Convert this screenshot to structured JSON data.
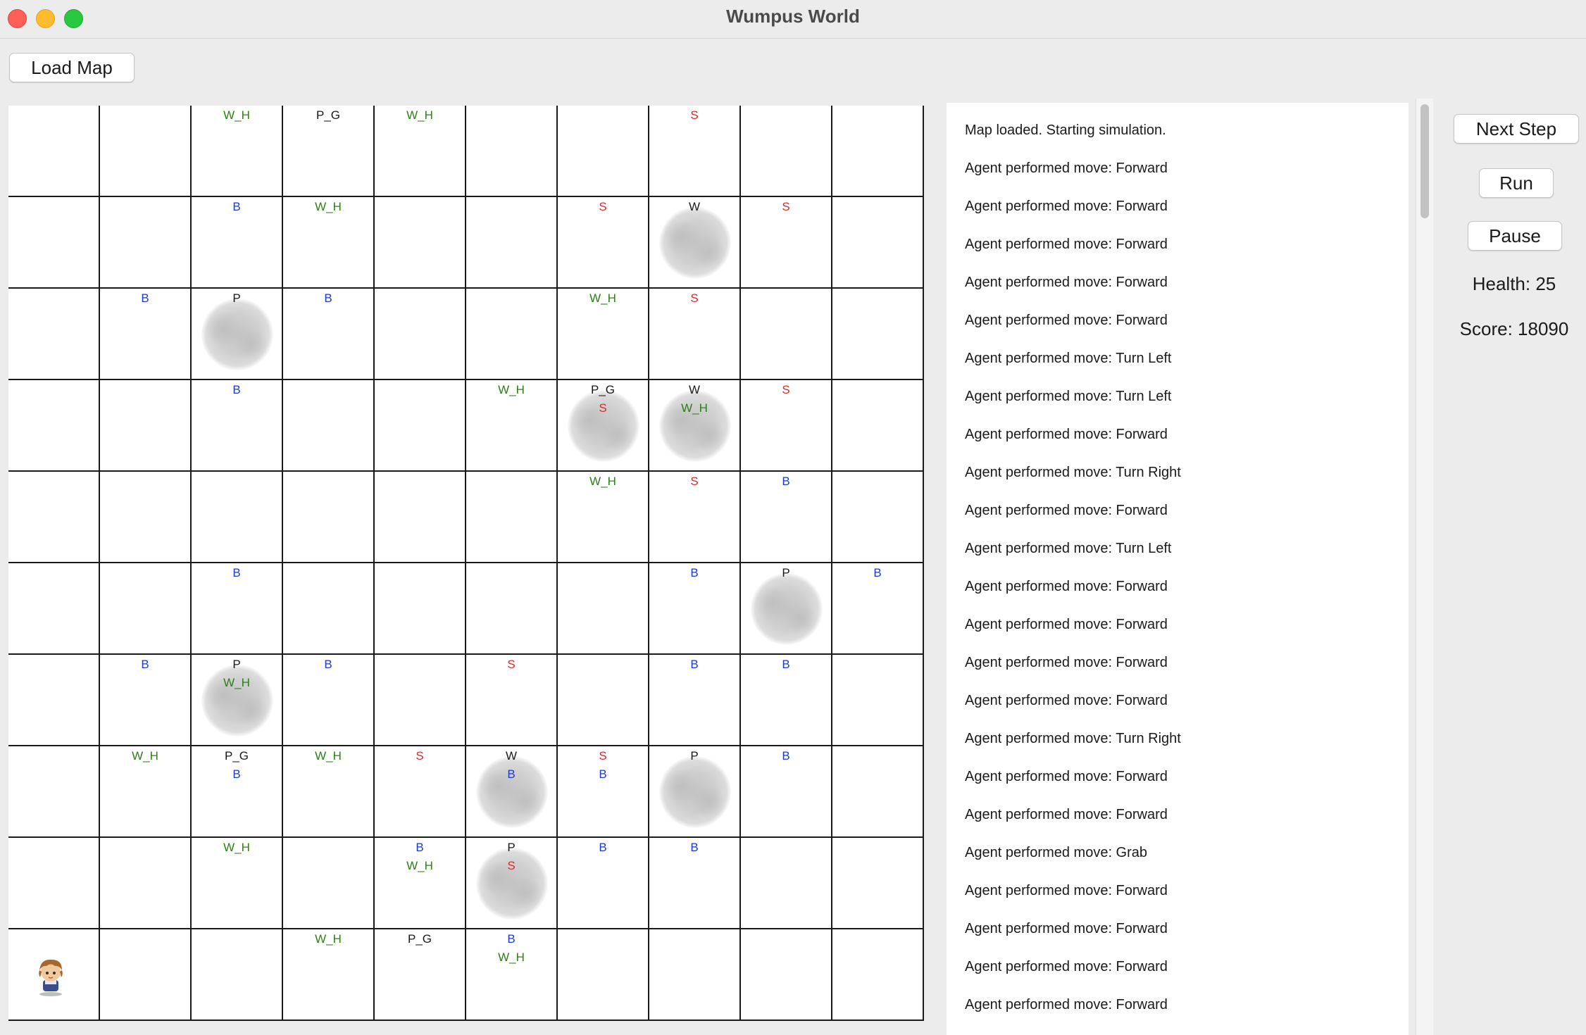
{
  "window": {
    "title": "Wumpus World"
  },
  "toolbar": {
    "load_map_label": "Load Map"
  },
  "controls": {
    "next_step_label": "Next Step",
    "run_label": "Run",
    "pause_label": "Pause",
    "health_text": "Health: 25",
    "score_text": "Score: 18090"
  },
  "legend_colors": {
    "P_G": "#1a1a1a",
    "P": "#1a1a1a",
    "W": "#1a1a1a",
    "S": "#d62b2b",
    "B": "#1c3bd0",
    "W_H": "#2e7d1a"
  },
  "grid": {
    "rows": 10,
    "cols": 10,
    "cells": [
      {
        "r": 0,
        "c": 2,
        "labels": [
          "W_H"
        ]
      },
      {
        "r": 0,
        "c": 3,
        "labels": [
          "P_G"
        ]
      },
      {
        "r": 0,
        "c": 4,
        "labels": [
          "W_H"
        ]
      },
      {
        "r": 0,
        "c": 7,
        "labels": [
          "S"
        ]
      },
      {
        "r": 1,
        "c": 2,
        "labels": [
          "B"
        ]
      },
      {
        "r": 1,
        "c": 3,
        "labels": [
          "W_H"
        ]
      },
      {
        "r": 1,
        "c": 6,
        "labels": [
          "S"
        ]
      },
      {
        "r": 1,
        "c": 7,
        "labels": [
          "W"
        ],
        "fog": true
      },
      {
        "r": 1,
        "c": 8,
        "labels": [
          "S"
        ]
      },
      {
        "r": 2,
        "c": 1,
        "labels": [
          "B"
        ]
      },
      {
        "r": 2,
        "c": 2,
        "labels": [
          "P"
        ],
        "fog": true
      },
      {
        "r": 2,
        "c": 3,
        "labels": [
          "B"
        ]
      },
      {
        "r": 2,
        "c": 6,
        "labels": [
          "W_H"
        ]
      },
      {
        "r": 2,
        "c": 7,
        "labels": [
          "S"
        ]
      },
      {
        "r": 3,
        "c": 2,
        "labels": [
          "B"
        ]
      },
      {
        "r": 3,
        "c": 5,
        "labels": [
          "W_H"
        ]
      },
      {
        "r": 3,
        "c": 6,
        "labels": [
          "P_G",
          "S"
        ],
        "fog": true
      },
      {
        "r": 3,
        "c": 7,
        "labels": [
          "W",
          "W_H"
        ],
        "fog": true
      },
      {
        "r": 3,
        "c": 8,
        "labels": [
          "S"
        ]
      },
      {
        "r": 4,
        "c": 6,
        "labels": [
          "W_H"
        ]
      },
      {
        "r": 4,
        "c": 7,
        "labels": [
          "S"
        ]
      },
      {
        "r": 4,
        "c": 8,
        "labels": [
          "B"
        ]
      },
      {
        "r": 5,
        "c": 2,
        "labels": [
          "B"
        ]
      },
      {
        "r": 5,
        "c": 7,
        "labels": [
          "B"
        ]
      },
      {
        "r": 5,
        "c": 8,
        "labels": [
          "P"
        ],
        "fog": true
      },
      {
        "r": 5,
        "c": 9,
        "labels": [
          "B"
        ]
      },
      {
        "r": 6,
        "c": 1,
        "labels": [
          "B"
        ]
      },
      {
        "r": 6,
        "c": 2,
        "labels": [
          "P",
          "W_H"
        ],
        "fog": true
      },
      {
        "r": 6,
        "c": 3,
        "labels": [
          "B"
        ]
      },
      {
        "r": 6,
        "c": 5,
        "labels": [
          "S"
        ]
      },
      {
        "r": 6,
        "c": 7,
        "labels": [
          "B"
        ]
      },
      {
        "r": 6,
        "c": 8,
        "labels": [
          "B"
        ]
      },
      {
        "r": 7,
        "c": 1,
        "labels": [
          "W_H"
        ]
      },
      {
        "r": 7,
        "c": 2,
        "labels": [
          "P_G",
          "B"
        ]
      },
      {
        "r": 7,
        "c": 3,
        "labels": [
          "W_H"
        ]
      },
      {
        "r": 7,
        "c": 4,
        "labels": [
          "S"
        ]
      },
      {
        "r": 7,
        "c": 5,
        "labels": [
          "W",
          "B"
        ],
        "fog": true
      },
      {
        "r": 7,
        "c": 6,
        "labels": [
          "S",
          "B"
        ]
      },
      {
        "r": 7,
        "c": 7,
        "labels": [
          "P"
        ],
        "fog": true
      },
      {
        "r": 7,
        "c": 8,
        "labels": [
          "B"
        ]
      },
      {
        "r": 8,
        "c": 2,
        "labels": [
          "W_H"
        ]
      },
      {
        "r": 8,
        "c": 4,
        "labels": [
          "B",
          "W_H"
        ]
      },
      {
        "r": 8,
        "c": 5,
        "labels": [
          "P",
          "S"
        ],
        "fog": true
      },
      {
        "r": 8,
        "c": 6,
        "labels": [
          "B"
        ]
      },
      {
        "r": 8,
        "c": 7,
        "labels": [
          "B"
        ]
      },
      {
        "r": 9,
        "c": 0,
        "labels": [],
        "agent": true
      },
      {
        "r": 9,
        "c": 3,
        "labels": [
          "W_H"
        ]
      },
      {
        "r": 9,
        "c": 4,
        "labels": [
          "P_G"
        ]
      },
      {
        "r": 9,
        "c": 5,
        "labels": [
          "B",
          "W_H"
        ]
      }
    ]
  },
  "log": [
    "Map loaded. Starting simulation.",
    "Agent performed move: Forward",
    "Agent performed move: Forward",
    "Agent performed move: Forward",
    "Agent performed move: Forward",
    "Agent performed move: Forward",
    "Agent performed move: Turn Left",
    "Agent performed move: Turn Left",
    "Agent performed move: Forward",
    "Agent performed move: Turn Right",
    "Agent performed move: Forward",
    "Agent performed move: Turn Left",
    "Agent performed move: Forward",
    "Agent performed move: Forward",
    "Agent performed move: Forward",
    "Agent performed move: Forward",
    "Agent performed move: Turn Right",
    "Agent performed move: Forward",
    "Agent performed move: Forward",
    "Agent performed move: Grab",
    "Agent performed move: Forward",
    "Agent performed move: Forward",
    "Agent performed move: Forward",
    "Agent performed move: Forward"
  ]
}
